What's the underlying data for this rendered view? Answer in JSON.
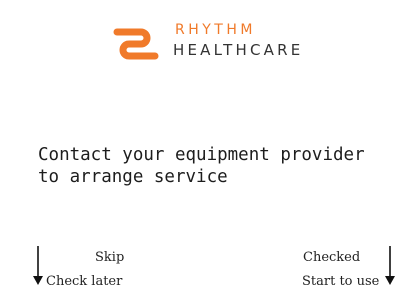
{
  "brand": {
    "line1": "RHYTHM",
    "line2": "HEALTHCARE",
    "accent_color": "#f07a2a",
    "logo_icon": "rhythm-logo-icon"
  },
  "message": {
    "text": "Contact your equipment provider\nto arrange service"
  },
  "actions": {
    "left": {
      "top_label": "Skip",
      "bottom_label": "Check later",
      "icon": "arrow-down-icon"
    },
    "right": {
      "top_label": "Checked",
      "bottom_label": "Start to use",
      "icon": "arrow-down-icon"
    }
  }
}
